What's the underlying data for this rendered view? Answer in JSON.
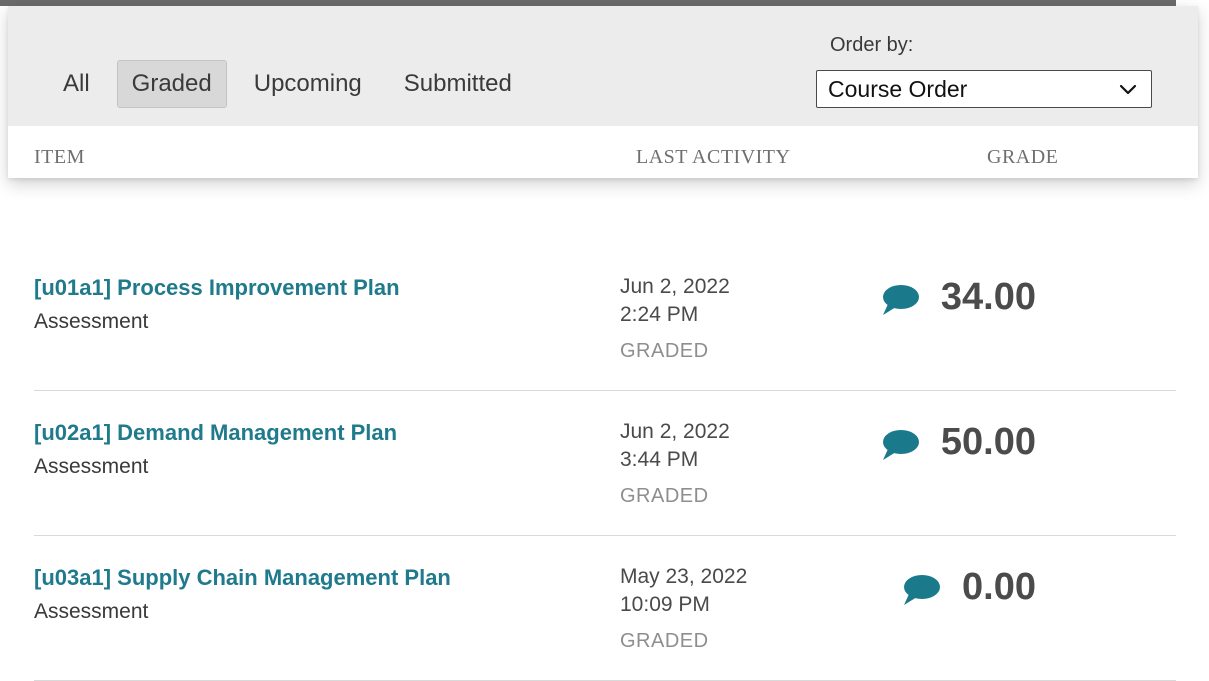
{
  "filters": {
    "tabs": [
      {
        "label": "All",
        "active": false
      },
      {
        "label": "Graded",
        "active": true
      },
      {
        "label": "Upcoming",
        "active": false
      },
      {
        "label": "Submitted",
        "active": false
      }
    ]
  },
  "order": {
    "label": "Order by:",
    "selected": "Course Order"
  },
  "columns": {
    "item": "ITEM",
    "last_activity": "LAST ACTIVITY",
    "grade": "GRADE"
  },
  "rows": [
    {
      "title": "[u01a1] Process Improvement Plan",
      "type": "Assessment",
      "date": "Jun 2, 2022",
      "time": "2:24 PM",
      "status": "GRADED",
      "grade": "34.00"
    },
    {
      "title": "[u02a1] Demand Management Plan",
      "type": "Assessment",
      "date": "Jun 2, 2022",
      "time": "3:44 PM",
      "status": "GRADED",
      "grade": "50.00"
    },
    {
      "title": "[u03a1] Supply Chain Management Plan",
      "type": "Assessment",
      "date": "May 23, 2022",
      "time": "10:09 PM",
      "status": "GRADED",
      "grade": "0.00"
    }
  ],
  "icons": {
    "comment": "comment-icon",
    "dropdown": "chevron-down-icon"
  },
  "colors": {
    "link": "#1f7a8c",
    "comment_icon": "#1a7a8c",
    "grade_text": "#4b4b4b",
    "header_bg": "#ececec"
  }
}
